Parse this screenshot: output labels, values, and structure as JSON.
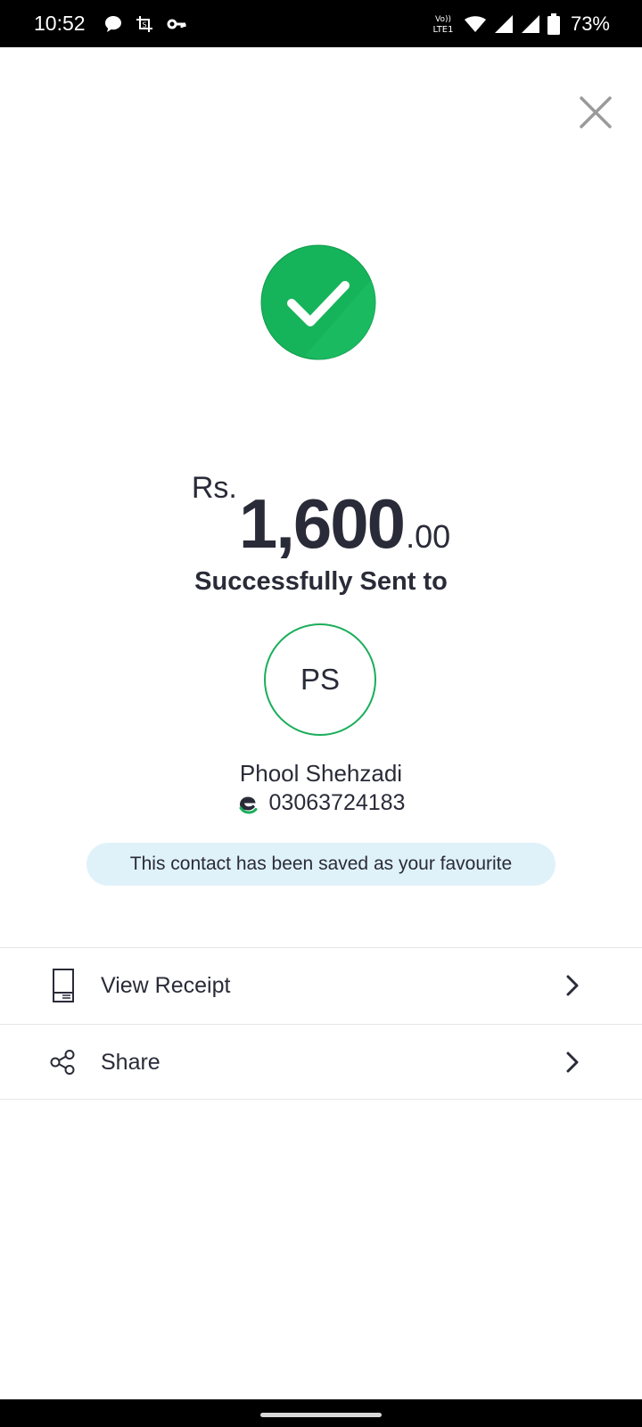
{
  "status_bar": {
    "time": "10:52",
    "battery_percent": "73%",
    "network_label": "LTE1"
  },
  "amount": {
    "currency": "Rs.",
    "whole": "1,600",
    "decimals": ".00"
  },
  "sent_to_label": "Successfully Sent to",
  "recipient": {
    "initials": "PS",
    "name": "Phool Shehzadi",
    "number": "03063724183"
  },
  "favourite_note": "This contact has been saved as your favourite",
  "actions": {
    "view_receipt": "View Receipt",
    "share": "Share"
  },
  "colors": {
    "success_green": "#1aae5a",
    "text_dark": "#2a2b38",
    "pill_bg": "#dff2fa"
  }
}
